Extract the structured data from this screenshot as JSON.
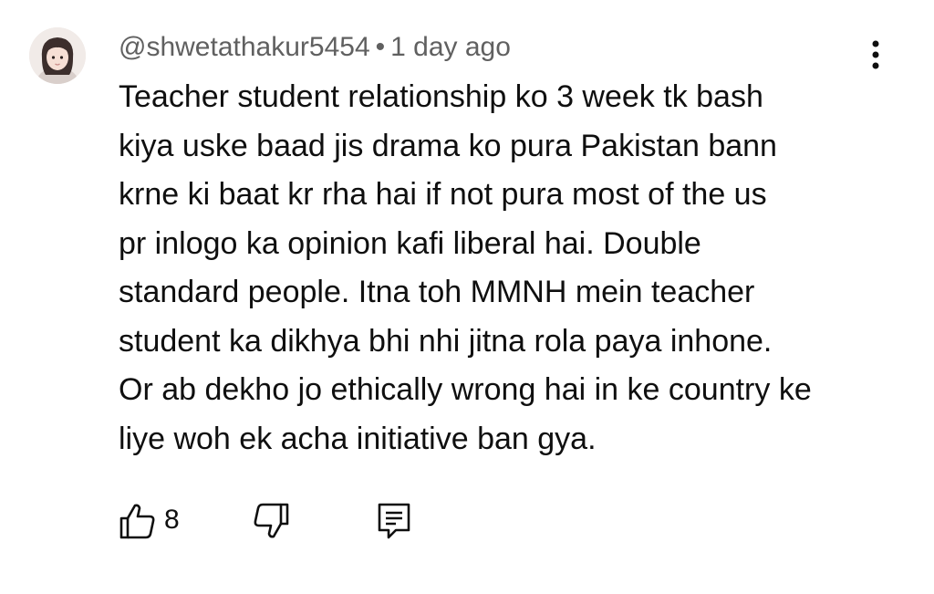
{
  "comment": {
    "username": "@shwetathakur5454",
    "separator": "•",
    "time": "1 day ago",
    "lines": [
      "Teacher student relationship ko 3 week tk bash",
      "kiya uske baad jis drama ko pura Pakistan bann",
      "krne ki baat kr rha hai if not pura most of the us",
      "pr inlogo ka opinion kafi liberal hai. Double",
      "standard people. Itna toh MMNH mein teacher",
      "student ka dikhya bhi nhi jitna rola paya inhone.",
      "Or ab dekho jo ethically wrong hai in ke country ke",
      "liye woh ek acha initiative ban gya."
    ],
    "like_count": "8"
  },
  "icons": {
    "avatar": "avatar",
    "more": "more-vert-icon",
    "like": "thumb-up-icon",
    "dislike": "thumb-down-icon",
    "reply": "comment-reply-icon"
  },
  "colors": {
    "text": "#0f0f0f",
    "meta": "#606060",
    "background": "#ffffff"
  }
}
